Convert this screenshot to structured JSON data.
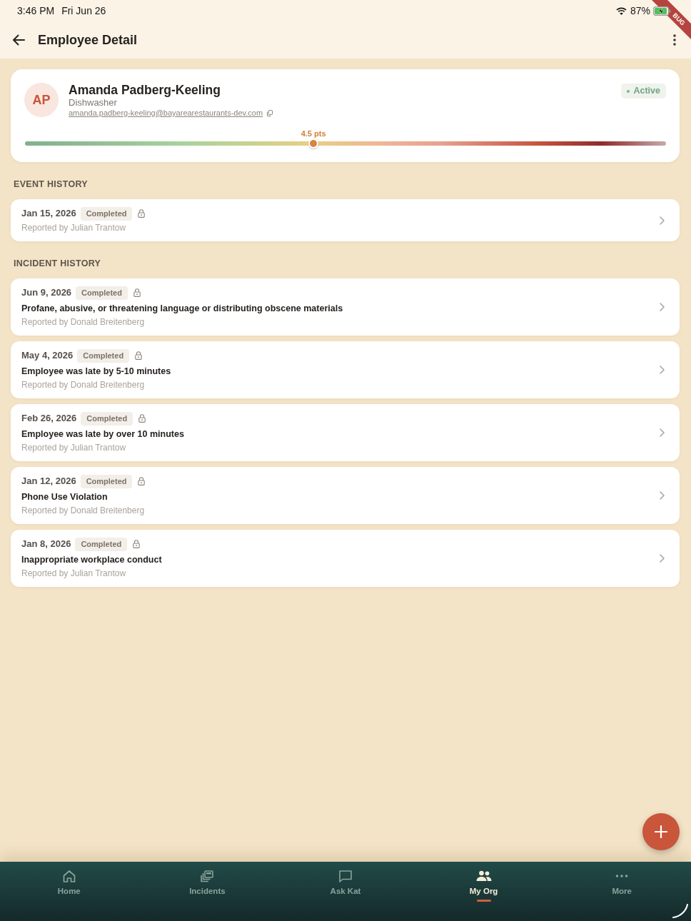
{
  "status_bar": {
    "time": "3:46 PM",
    "date": "Fri Jun 26",
    "battery": "87%"
  },
  "debug_banner": {
    "label": "BUG"
  },
  "app_bar": {
    "title": "Employee Detail"
  },
  "employee": {
    "initials": "AP",
    "name": "Amanda Padberg-Keeling",
    "role": "Dishwasher",
    "email": "amanda.padberg-keeling@bayarearestaurants-dev.com",
    "status": "Active",
    "score": {
      "label": "4.5 pts",
      "level": 0.45
    }
  },
  "sections": [
    {
      "title": "EVENT HISTORY",
      "items": [
        {
          "date": "Jan 15, 2026",
          "status": "Completed",
          "locked": true,
          "reported_by": "Reported by Julian Trantow"
        }
      ]
    },
    {
      "title": "INCIDENT HISTORY",
      "items": [
        {
          "date": "Jun 9, 2026",
          "status": "Completed",
          "locked": true,
          "title": "Profane, abusive, or threatening language or distributing obscene materials",
          "reported_by": "Reported by Donald Breitenberg"
        },
        {
          "date": "May 4, 2026",
          "status": "Completed",
          "locked": true,
          "title": "Employee was late by 5-10 minutes",
          "reported_by": "Reported by Donald Breitenberg"
        },
        {
          "date": "Feb 26, 2026",
          "status": "Completed",
          "locked": true,
          "title": "Employee was late by over 10 minutes",
          "reported_by": "Reported by Julian Trantow"
        },
        {
          "date": "Jan 12, 2026",
          "status": "Completed",
          "locked": true,
          "title": "Phone Use Violation",
          "reported_by": "Reported by Donald Breitenberg"
        },
        {
          "date": "Jan 8, 2026",
          "status": "Completed",
          "locked": true,
          "title": "Inappropriate workplace conduct",
          "reported_by": "Reported by Julian Trantow"
        }
      ]
    }
  ],
  "nav": [
    {
      "kind": "home",
      "label": "Home",
      "selected": false
    },
    {
      "kind": "incidents",
      "label": "Incidents",
      "selected": false
    },
    {
      "kind": "chat",
      "label": "Ask Kat",
      "selected": false
    },
    {
      "kind": "people",
      "label": "My Org",
      "selected": true
    },
    {
      "kind": "more",
      "label": "More",
      "selected": false
    }
  ]
}
